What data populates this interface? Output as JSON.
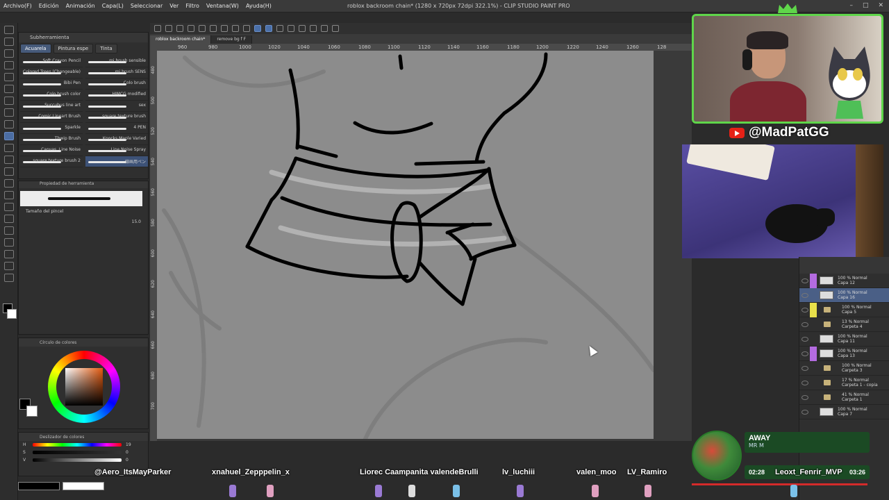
{
  "window": {
    "title": "roblox backroom chain* (1280 x 720px 72dpi 322.1%) - CLIP STUDIO PAINT PRO"
  },
  "menu": [
    "Archivo(F)",
    "Edición",
    "Animación",
    "Capa(L)",
    "Seleccionar",
    "Ver",
    "Filtro",
    "Ventana(W)",
    "Ayuda(H)"
  ],
  "subtool_panel": {
    "header": "Subherramienta",
    "tabs": [
      "Acuarela",
      "Pintura espe",
      "Tinta"
    ],
    "brushes_left": [
      "Soft Crayon Pencil",
      "Colored Trees (Changeable)",
      "Bibi Pen",
      "Colo brush color",
      "Succubus line art",
      "Comic Lineart Brush",
      "Sparkle",
      "Thwip Brush",
      "Canvas, Line Noise",
      "square texture brush 2"
    ],
    "brushes_right": [
      "mi brush sensible",
      "mi brush SENS",
      "Colo brush",
      "HIMCG modified",
      "sex",
      "square texture brush",
      "4 PEN",
      "Knocks Maple Varied",
      "Line Noise Spray",
      "線画用ペン"
    ]
  },
  "tool_property": {
    "header": "Propiedad de herramienta",
    "brush_size_label": "Tamaño del pincel",
    "brush_size_value": "15.0"
  },
  "color_wheel": {
    "header": "Círculo de colores",
    "foreground": "#000000",
    "background": "#ffffff"
  },
  "color_slider": {
    "header": "Deslizador de colores",
    "h_label": "H",
    "h_value": "19",
    "s_label": "S",
    "s_value": "0",
    "v_label": "V",
    "v_value": "0"
  },
  "doc_tabs": [
    "roblox backroom chain*",
    "remove bg  f  F"
  ],
  "ruler_top": [
    "960",
    "980",
    "1000",
    "1020",
    "1040",
    "1060",
    "1080",
    "1100",
    "1120",
    "1140",
    "1160",
    "1180",
    "1200",
    "1220",
    "1240",
    "1260",
    "128"
  ],
  "ruler_left": [
    "480",
    "500",
    "520",
    "540",
    "560",
    "580",
    "600",
    "620",
    "640",
    "660",
    "680",
    "700"
  ],
  "stream": {
    "handle": "@MadPatGG"
  },
  "layers": [
    {
      "text1": "100 % Normal",
      "text2": "Capa 12",
      "color": "#b46be0",
      "kind": "layer"
    },
    {
      "text1": "100 % Normal",
      "text2": "Capa 16",
      "color": "",
      "kind": "layer",
      "selected": true
    },
    {
      "text1": "100 % Normal",
      "text2": "Capa 5",
      "color": "#e8e04a",
      "kind": "folder"
    },
    {
      "text1": "13 % Normal",
      "text2": "Carpeta 4",
      "color": "",
      "kind": "folder"
    },
    {
      "text1": "100 % Normal",
      "text2": "Capa 11",
      "color": "",
      "kind": "layer"
    },
    {
      "text1": "100 % Normal",
      "text2": "Capa 13",
      "color": "#b46be0",
      "kind": "layer"
    },
    {
      "text1": "100 % Normal",
      "text2": "Carpeta 3",
      "color": "",
      "kind": "folder"
    },
    {
      "text1": "17 % Normal",
      "text2": "Carpeta 1 - copia",
      "color": "",
      "kind": "folder"
    },
    {
      "text1": "41 % Normal",
      "text2": "Carpeta 1",
      "color": "",
      "kind": "folder"
    },
    {
      "text1": "100 % Normal",
      "text2": "Capa 7",
      "color": "",
      "kind": "layer"
    }
  ],
  "away": {
    "title": "AWAY",
    "subtitle": "MR M",
    "time_left": "02:28",
    "time_right": "03:26",
    "progress": 0.99
  },
  "chat_names": [
    "@Aero_ItsMayParker",
    "xnahuel_Zepppelin_x",
    "Liorec Caampanita valendeBrulli",
    "lv_luchiii",
    "valen_moo",
    "LV_Ramiro",
    "Leoxt_Fenrir_MVP"
  ]
}
